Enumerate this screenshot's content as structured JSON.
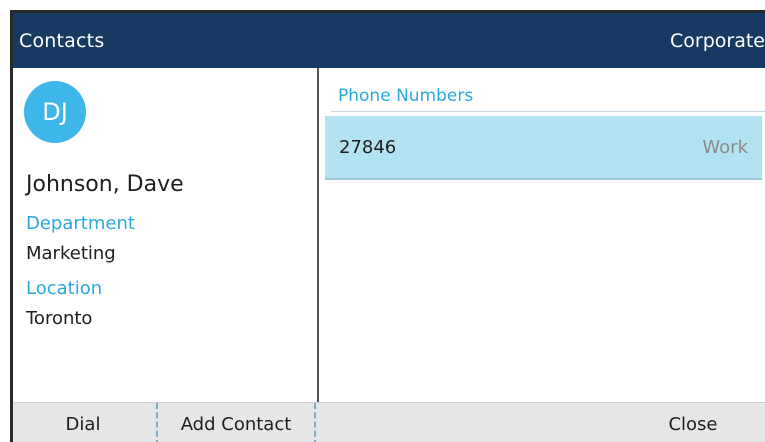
{
  "header": {
    "title": "Contacts",
    "directory": "Corporate"
  },
  "contact": {
    "initials": "DJ",
    "name": "Johnson, Dave",
    "department_label": "Department",
    "department": "Marketing",
    "location_label": "Location",
    "location": "Toronto"
  },
  "phones": {
    "section_title": "Phone Numbers",
    "items": [
      {
        "number": "27846",
        "type": "Work"
      }
    ]
  },
  "softkeys": {
    "dial": "Dial",
    "add_contact": "Add Contact",
    "close": "Close"
  },
  "colors": {
    "header_bg": "#173a63",
    "accent": "#2aa8e0",
    "avatar_bg": "#3fb6ea",
    "selected_row": "#b3e3f3",
    "softkey_bar": "#e6e6e6"
  }
}
